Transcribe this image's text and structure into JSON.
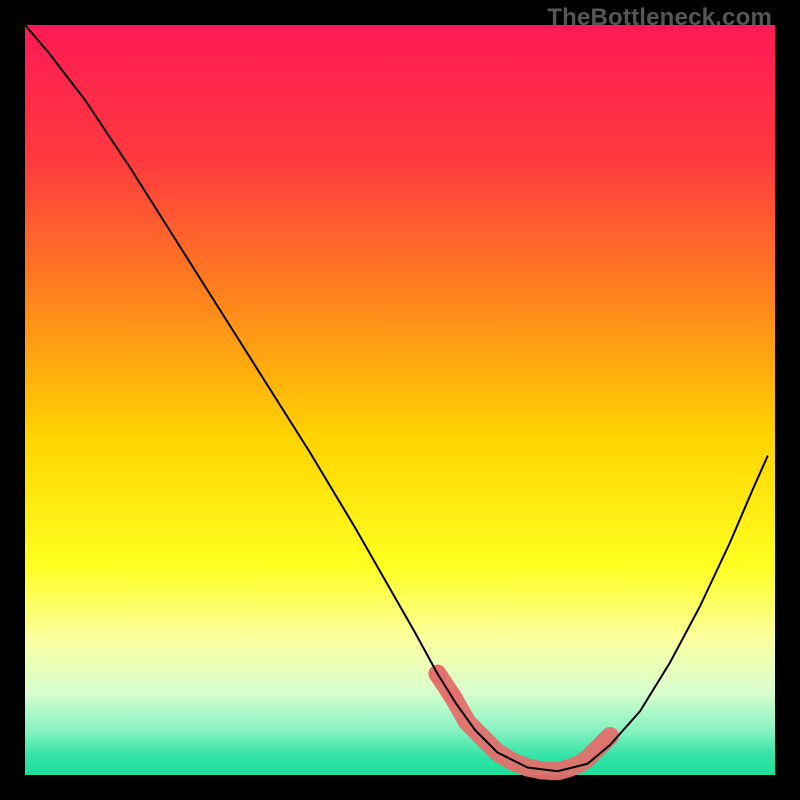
{
  "watermark": "TheBottleneck.com",
  "chart_data": {
    "type": "line",
    "title": "",
    "xlabel": "",
    "ylabel": "",
    "xlim": [
      0,
      100
    ],
    "ylim": [
      0,
      100
    ],
    "background_gradient_stops": [
      {
        "pos": 0.0,
        "color": "#ff1a55"
      },
      {
        "pos": 0.18,
        "color": "#ff3a3e"
      },
      {
        "pos": 0.38,
        "color": "#ff8a1a"
      },
      {
        "pos": 0.55,
        "color": "#ffd400"
      },
      {
        "pos": 0.72,
        "color": "#ffff20"
      },
      {
        "pos": 0.82,
        "color": "#fbffa0"
      },
      {
        "pos": 0.89,
        "color": "#d8ffcf"
      },
      {
        "pos": 0.94,
        "color": "#88f3c2"
      },
      {
        "pos": 0.975,
        "color": "#32e3a6"
      },
      {
        "pos": 1.0,
        "color": "#1fdf99"
      }
    ],
    "series": [
      {
        "name": "bottleneck-curve",
        "color": "#000000",
        "width": 2,
        "x": [
          0.0,
          3.0,
          8.0,
          14.0,
          20.0,
          26.0,
          32.0,
          38.0,
          44.0,
          48.0,
          52.0,
          55.0,
          57.5,
          60.0,
          63.0,
          67.0,
          71.0,
          75.0,
          78.0,
          82.0,
          86.0,
          90.0,
          94.0,
          97.0,
          99.0
        ],
        "y": [
          100.0,
          96.5,
          90.0,
          81.0,
          71.5,
          62.0,
          52.5,
          43.0,
          33.0,
          26.0,
          19.0,
          13.5,
          9.5,
          6.0,
          3.0,
          1.0,
          0.5,
          1.5,
          4.0,
          8.5,
          15.0,
          22.5,
          31.0,
          38.0,
          42.5
        ]
      },
      {
        "name": "highlight-band",
        "type": "scatter",
        "color": "#e46f6b",
        "radius": 9,
        "x": [
          55.0,
          57.0,
          59.0,
          61.0,
          63.0,
          65.0,
          67.0,
          69.0,
          71.0,
          72.5,
          74.0,
          75.0,
          76.0,
          77.0,
          78.0
        ],
        "y": [
          13.5,
          10.5,
          7.0,
          5.0,
          3.0,
          1.8,
          1.0,
          0.6,
          0.5,
          0.9,
          1.5,
          2.2,
          3.2,
          4.2,
          5.2
        ]
      }
    ]
  }
}
